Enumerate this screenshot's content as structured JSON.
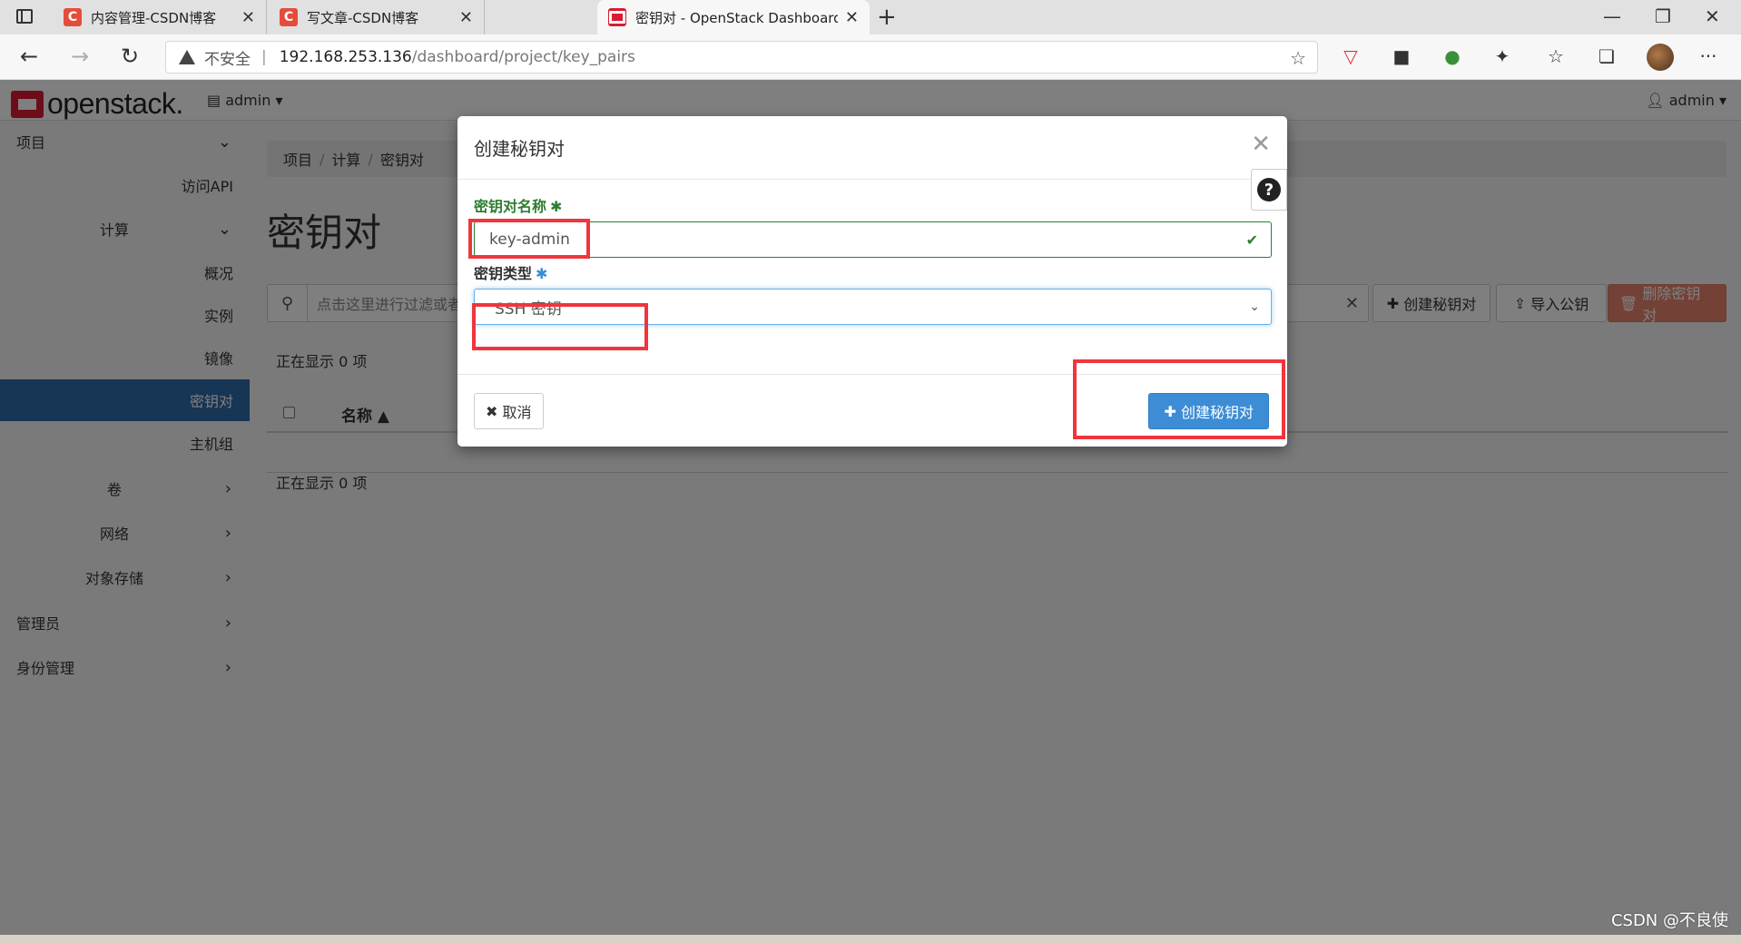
{
  "browser": {
    "tabs": [
      {
        "title": "内容管理-CSDN博客",
        "favicon": "C",
        "active": false
      },
      {
        "title": "写文章-CSDN博客",
        "favicon": "C",
        "active": false
      },
      {
        "title": "密钥对 - OpenStack Dashboard",
        "favicon": "",
        "active": true
      }
    ],
    "new_tab": "+",
    "window_controls": {
      "minimize": "—",
      "restore": "❐",
      "close": "✕"
    },
    "address": {
      "insecure_label": "不安全",
      "host": "192.168.253.136",
      "path": "/dashboard/project/key_pairs"
    },
    "nav": {
      "back": "←",
      "forward": "→",
      "reload": "↻"
    },
    "more": "···"
  },
  "header": {
    "logo_text": "openstack.",
    "project_menu": "admin",
    "user_menu": "admin"
  },
  "sidebar": {
    "items": [
      {
        "label": "项目",
        "chevron": "⌄"
      },
      {
        "label": "访问API",
        "chevron": ""
      },
      {
        "label": "计算",
        "chevron": "⌄"
      },
      {
        "label": "概况",
        "chevron": ""
      },
      {
        "label": "实例",
        "chevron": ""
      },
      {
        "label": "镜像",
        "chevron": ""
      },
      {
        "label": "密钥对",
        "chevron": ""
      },
      {
        "label": "主机组",
        "chevron": ""
      },
      {
        "label": "卷",
        "chevron": "›"
      },
      {
        "label": "网络",
        "chevron": "›"
      },
      {
        "label": "对象存储",
        "chevron": "›"
      },
      {
        "label": "管理员",
        "chevron": "›"
      },
      {
        "label": "身份管理",
        "chevron": "›"
      }
    ]
  },
  "main": {
    "breadcrumb": [
      "项目",
      "计算",
      "密钥对"
    ],
    "title": "密钥对",
    "filter_placeholder": "点击这里进行过滤或者",
    "buttons": {
      "create": "创建秘钥对",
      "import": "导入公钥",
      "delete": "删除密钥对"
    },
    "count_top": "正在显示 0 项",
    "count_bottom": "正在显示 0 项",
    "column_name": "名称"
  },
  "modal": {
    "title": "创建秘钥对",
    "help": "?",
    "name_label": "密钥对名称",
    "name_value": "key-admin",
    "type_label": "密钥类型",
    "type_value": "SSH 密钥",
    "required_mark": "✱",
    "cancel_label": "取消",
    "submit_label": "创建秘钥对"
  },
  "watermark": "CSDN @不良使",
  "colors": {
    "accent_blue": "#3c8dd6",
    "highlight_red": "#f0353d",
    "valid_green": "#2e7d32",
    "sidebar_active": "#2f6aa8",
    "danger_button": "#e8826f"
  }
}
